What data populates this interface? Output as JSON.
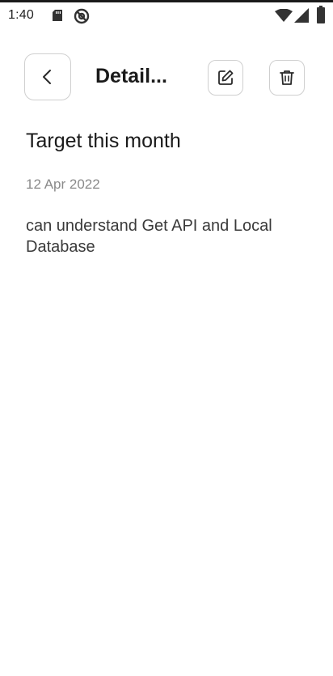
{
  "status_bar": {
    "time": "1:40",
    "icons": [
      "sd-card-icon",
      "at-sign-icon",
      "wifi-icon",
      "cell-signal-icon",
      "battery-icon"
    ]
  },
  "header": {
    "title": "Detail...",
    "back_icon": "chevron-left-icon",
    "edit_icon": "edit-icon",
    "delete_icon": "trash-icon"
  },
  "note": {
    "title": "Target this month",
    "date": "12 Apr 2022",
    "body": "can understand Get API and Local Database"
  },
  "colors": {
    "border": "#cfcfcf",
    "date_text": "#8a8a8a",
    "primary_text": "#1a1a1a"
  }
}
